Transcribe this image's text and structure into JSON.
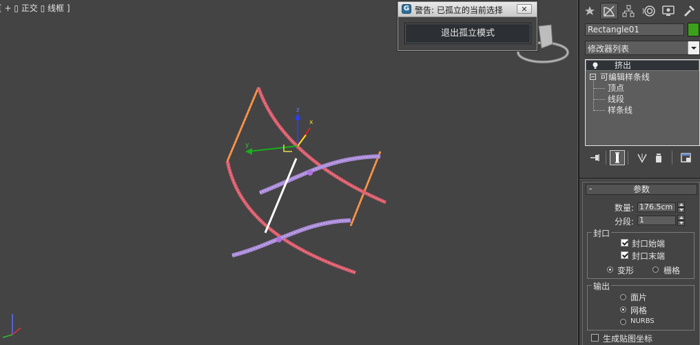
{
  "viewport": {
    "label": "[ + ▯ 正交 ▯ 线框 ]"
  },
  "gizmo": {
    "x_label": "x",
    "y_label": "y",
    "z_label": "z"
  },
  "isolation_dialog": {
    "title": "警告: 已孤立的当前选择",
    "exit_button": "退出孤立模式",
    "close_glyph": "✕",
    "app_icon_glyph": "G"
  },
  "command_panel": {
    "tabs": [
      "create-icon",
      "modify-icon",
      "hierarchy-icon",
      "motion-icon",
      "display-icon",
      "utilities-icon"
    ],
    "active_tab": "modify-icon",
    "object_name": "Rectangle01",
    "object_color": "#3ba01a",
    "modifier_list_label": "修改器列表",
    "stack": {
      "top_modifier": "挤出",
      "base_object": "可编辑样条线",
      "sub_objects": [
        "顶点",
        "线段",
        "样条线"
      ]
    },
    "parameters": {
      "rollout_title": "参数",
      "rollout_toggle": "-",
      "amount_label": "数量:",
      "amount_value": "176.5cm",
      "segments_label": "分段:",
      "segments_value": "1",
      "capping_group": "封口",
      "cap_start_label": "封口始端",
      "cap_start_checked": true,
      "cap_end_label": "封口末端",
      "cap_end_checked": true,
      "morph_label": "变形",
      "grid_label": "栅格",
      "cap_type": "morph",
      "output_group": "输出",
      "output_patch_label": "面片",
      "output_mesh_label": "网格",
      "output_nurbs_label": "NURBS",
      "output_selected": "mesh",
      "gen_map_coords_label": "生成贴图坐标",
      "gen_map_coords_checked": false
    }
  }
}
